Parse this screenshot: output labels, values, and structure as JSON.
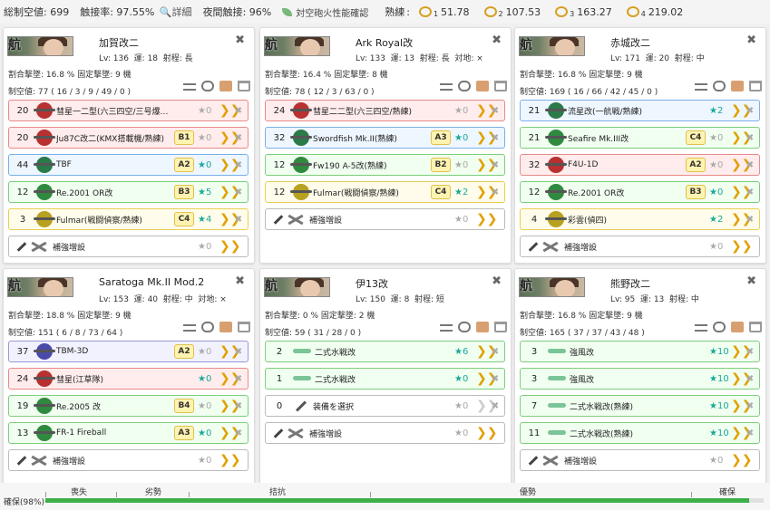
{
  "topbar": {
    "air_power_label": "総制空値",
    "air_power": "699",
    "contact_label": "触接率",
    "contact": "97.55%",
    "detail": "詳細",
    "night_contact_label": "夜間触接",
    "night_contact": "96%",
    "aa_check": "対空砲火性能確認",
    "proficiency_label": "熟練",
    "prof": [
      {
        "n": "1",
        "v": "51.78"
      },
      {
        "n": "2",
        "v": "107.53"
      },
      {
        "n": "3",
        "v": "163.27"
      },
      {
        "n": "4",
        "v": "219.02"
      }
    ]
  },
  "ships": [
    {
      "name": "加賀改二",
      "lv": "136",
      "luck": "18",
      "range": "長",
      "asw": "",
      "line1": "割合撃墜: 16.8 %  固定撃墜: 9 機",
      "line2": "制空値: 77 ( 16 / 3 / 9 / 49 / 0 )",
      "slots": [
        {
          "cnt": "20",
          "color": "red",
          "icon": "bomb",
          "name": "彗星一二型(六三四空/三号爆弾搭...",
          "badge": "",
          "star": "0",
          "star_on": false
        },
        {
          "cnt": "20",
          "color": "red",
          "icon": "bomb",
          "name": "Ju87C改二(KMX搭載機/熟練)",
          "badge": "B1",
          "star": "0",
          "star_on": false
        },
        {
          "cnt": "44",
          "color": "blue",
          "icon": "torp",
          "name": "TBF",
          "badge": "A2",
          "star": "0",
          "star_on": true
        },
        {
          "cnt": "12",
          "color": "green",
          "icon": "fight",
          "name": "Re.2001 OR改",
          "badge": "B3",
          "star": "5",
          "star_on": true
        },
        {
          "cnt": "3",
          "color": "yellow",
          "icon": "recon",
          "name": "Fulmar(戦闘偵察/熟練)",
          "badge": "C4",
          "star": "4",
          "star_on": true
        }
      ],
      "reinforce": "補強増設"
    },
    {
      "name": "Ark Royal改",
      "lv": "133",
      "luck": "13",
      "range": "長",
      "asw": "×",
      "line1": "割合撃墜: 16.4 %  固定撃墜: 8 機",
      "line2": "制空値: 78 ( 12 / 3 / 63 / 0 )",
      "slots": [
        {
          "cnt": "24",
          "color": "red",
          "icon": "bomb",
          "name": "彗星二二型(六三四空/熟練)",
          "badge": "",
          "star": "0",
          "star_on": false
        },
        {
          "cnt": "32",
          "color": "blue",
          "icon": "torp",
          "name": "Swordfish Mk.II(熟練)",
          "badge": "A3",
          "star": "0",
          "star_on": true
        },
        {
          "cnt": "12",
          "color": "green",
          "icon": "fight",
          "name": "Fw190 A-5改(熟練)",
          "badge": "B2",
          "star": "0",
          "star_on": false
        },
        {
          "cnt": "12",
          "color": "yellow",
          "icon": "recon",
          "name": "Fulmar(戦闘偵察/熟練)",
          "badge": "C4",
          "star": "2",
          "star_on": true
        }
      ],
      "reinforce": "補強増設"
    },
    {
      "name": "赤城改二",
      "lv": "171",
      "luck": "20",
      "range": "中",
      "asw": "",
      "line1": "割合撃墜: 16.8 %  固定撃墜: 9 機",
      "line2": "制空値: 169 ( 16 / 66 / 42 / 45 / 0 )",
      "slots": [
        {
          "cnt": "21",
          "color": "blue",
          "icon": "torp",
          "name": "流星改(一航戦/熟練)",
          "badge": "",
          "star": "2",
          "star_on": true
        },
        {
          "cnt": "21",
          "color": "green",
          "icon": "fight",
          "name": "Seafire Mk.III改",
          "badge": "C4",
          "star": "0",
          "star_on": false
        },
        {
          "cnt": "32",
          "color": "red",
          "icon": "bomb",
          "name": "F4U-1D",
          "badge": "A2",
          "star": "0",
          "star_on": false
        },
        {
          "cnt": "12",
          "color": "green",
          "icon": "fight",
          "name": "Re.2001 OR改",
          "badge": "B3",
          "star": "0",
          "star_on": true
        },
        {
          "cnt": "4",
          "color": "yellow",
          "icon": "recon",
          "name": "彩雲(偵四)",
          "badge": "",
          "star": "2",
          "star_on": true
        }
      ],
      "reinforce": "補強増設"
    },
    {
      "name": "Saratoga Mk.II Mod.2",
      "lv": "153",
      "luck": "40",
      "range": "中",
      "asw": "×",
      "line1": "割合撃墜: 18.8 %  固定撃墜: 9 機",
      "line2": "制空値: 151 ( 6 / 8 / 73 / 64 )",
      "slots": [
        {
          "cnt": "37",
          "color": "purple",
          "icon": "jet",
          "name": "TBM-3D",
          "badge": "A2",
          "star": "0",
          "star_on": false
        },
        {
          "cnt": "24",
          "color": "red",
          "icon": "bomb",
          "name": "彗星(江草隊)",
          "badge": "",
          "star": "0",
          "star_on": true
        },
        {
          "cnt": "19",
          "color": "green",
          "icon": "fight",
          "name": "Re.2005 改",
          "badge": "B4",
          "star": "0",
          "star_on": false
        },
        {
          "cnt": "13",
          "color": "green",
          "icon": "fight",
          "name": "FR-1 Fireball",
          "badge": "A3",
          "star": "0",
          "star_on": true
        }
      ],
      "reinforce": "補強増設"
    },
    {
      "name": "伊13改",
      "lv": "150",
      "luck": "8",
      "range": "短",
      "asw": "",
      "line1": "割合撃墜: 0 %  固定撃墜: 2 機",
      "line2": "制空値: 59 ( 31 / 28 / 0 )",
      "slots": [
        {
          "cnt": "2",
          "color": "green",
          "icon": "sea",
          "name": "二式水戦改",
          "badge": "",
          "star": "6",
          "star_on": true
        },
        {
          "cnt": "1",
          "color": "green",
          "icon": "sea",
          "name": "二式水戦改",
          "badge": "",
          "star": "0",
          "star_on": true
        },
        {
          "cnt": "0",
          "color": "grey",
          "icon": "tool",
          "name": "装備を選択",
          "badge": "",
          "star": "0",
          "star_on": false
        }
      ],
      "reinforce": "補強増設"
    },
    {
      "name": "熊野改二",
      "lv": "95",
      "luck": "13",
      "range": "中",
      "asw": "",
      "line1": "割合撃墜: 16.8 %  固定撃墜: 9 機",
      "line2": "制空値: 165 ( 37 / 37 / 43 / 48 )",
      "slots": [
        {
          "cnt": "3",
          "color": "green",
          "icon": "sea",
          "name": "強風改",
          "badge": "",
          "star": "10",
          "star_on": true
        },
        {
          "cnt": "3",
          "color": "green",
          "icon": "sea",
          "name": "強風改",
          "badge": "",
          "star": "10",
          "star_on": true
        },
        {
          "cnt": "7",
          "color": "green",
          "icon": "sea",
          "name": "二式水戦改(熟練)",
          "badge": "",
          "star": "10",
          "star_on": true
        },
        {
          "cnt": "11",
          "color": "green",
          "icon": "sea",
          "name": "二式水戦改(熟練)",
          "badge": "",
          "star": "10",
          "star_on": true
        }
      ],
      "reinforce": "補強増設"
    }
  ],
  "bottom": {
    "status": "確保(98%)",
    "labels": [
      "喪失",
      "劣勢",
      "拮抗",
      "優勢",
      "確保"
    ],
    "progress": 0.98,
    "accent": "#3cb04a"
  }
}
